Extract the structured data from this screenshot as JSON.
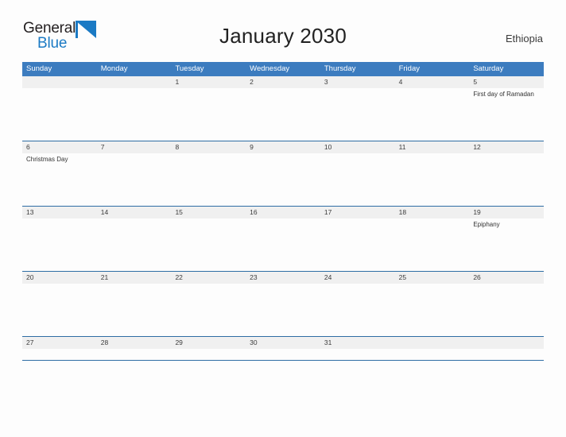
{
  "brand": {
    "name_part1": "General",
    "name_part2": "Blue",
    "flag_icon": "flag-triangle-icon",
    "color_primary": "#1b7ac4",
    "color_text": "#231f20"
  },
  "header": {
    "title": "January 2030",
    "country": "Ethiopia"
  },
  "calendar": {
    "header_bg": "#3c7cbf",
    "header_text_color": "#ffffff",
    "row_divider_color": "#2e6da4",
    "day_band_color": "#f0f0f0",
    "weekdays": [
      "Sunday",
      "Monday",
      "Tuesday",
      "Wednesday",
      "Thursday",
      "Friday",
      "Saturday"
    ],
    "weeks": [
      [
        {
          "date": "",
          "events": []
        },
        {
          "date": "",
          "events": []
        },
        {
          "date": "1",
          "events": []
        },
        {
          "date": "2",
          "events": []
        },
        {
          "date": "3",
          "events": []
        },
        {
          "date": "4",
          "events": []
        },
        {
          "date": "5",
          "events": [
            "First day of Ramadan"
          ]
        }
      ],
      [
        {
          "date": "6",
          "events": [
            "Christmas Day"
          ]
        },
        {
          "date": "7",
          "events": []
        },
        {
          "date": "8",
          "events": []
        },
        {
          "date": "9",
          "events": []
        },
        {
          "date": "10",
          "events": []
        },
        {
          "date": "11",
          "events": []
        },
        {
          "date": "12",
          "events": []
        }
      ],
      [
        {
          "date": "13",
          "events": []
        },
        {
          "date": "14",
          "events": []
        },
        {
          "date": "15",
          "events": []
        },
        {
          "date": "16",
          "events": []
        },
        {
          "date": "17",
          "events": []
        },
        {
          "date": "18",
          "events": []
        },
        {
          "date": "19",
          "events": [
            "Epiphany"
          ]
        }
      ],
      [
        {
          "date": "20",
          "events": []
        },
        {
          "date": "21",
          "events": []
        },
        {
          "date": "22",
          "events": []
        },
        {
          "date": "23",
          "events": []
        },
        {
          "date": "24",
          "events": []
        },
        {
          "date": "25",
          "events": []
        },
        {
          "date": "26",
          "events": []
        }
      ],
      [
        {
          "date": "27",
          "events": []
        },
        {
          "date": "28",
          "events": []
        },
        {
          "date": "29",
          "events": []
        },
        {
          "date": "30",
          "events": []
        },
        {
          "date": "31",
          "events": []
        },
        {
          "date": "",
          "events": []
        },
        {
          "date": "",
          "events": []
        }
      ]
    ]
  }
}
